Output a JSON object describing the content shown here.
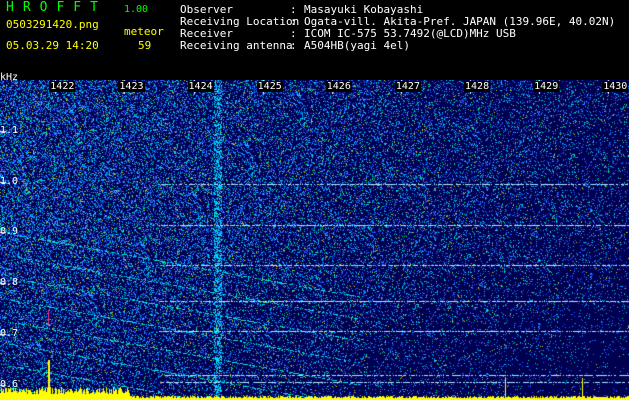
{
  "app": {
    "name": "HROFFT",
    "version": "1.00"
  },
  "file": {
    "name": "0503291420.png",
    "date_time": "05.03.29 14:20"
  },
  "meteor": {
    "label": "meteor",
    "count": "59"
  },
  "meta": [
    {
      "key": "Observer",
      "value": "Masayuki Kobayashi"
    },
    {
      "key": "Receiving Location",
      "value": "Ogata-vill. Akita-Pref. JAPAN (139.96E, 40.02N)"
    },
    {
      "key": "Receiver",
      "value": "ICOM IC-575 53.7492(@LCD)MHz USB"
    },
    {
      "key": "Receiving antenna",
      "value": "A504HB(yagi 4el)"
    }
  ],
  "spectrogram": {
    "ylabel": "kHz",
    "yticks": [
      "1.1",
      "1.0",
      "0.9",
      "0.8",
      "0.7",
      "0.6"
    ],
    "xticks": [
      "1422",
      "1423",
      "1424",
      "1425",
      "1426",
      "1427",
      "1428",
      "1429",
      "1430"
    ],
    "ylim": [
      0.57,
      1.2
    ],
    "xlim": [
      1421.2,
      1430.3
    ],
    "colors": {
      "bg": "#000050",
      "noise": "#1e50ff",
      "mid": "#00c8ff",
      "hot": "#ffff00",
      "meteor": "#ff2288"
    }
  }
}
